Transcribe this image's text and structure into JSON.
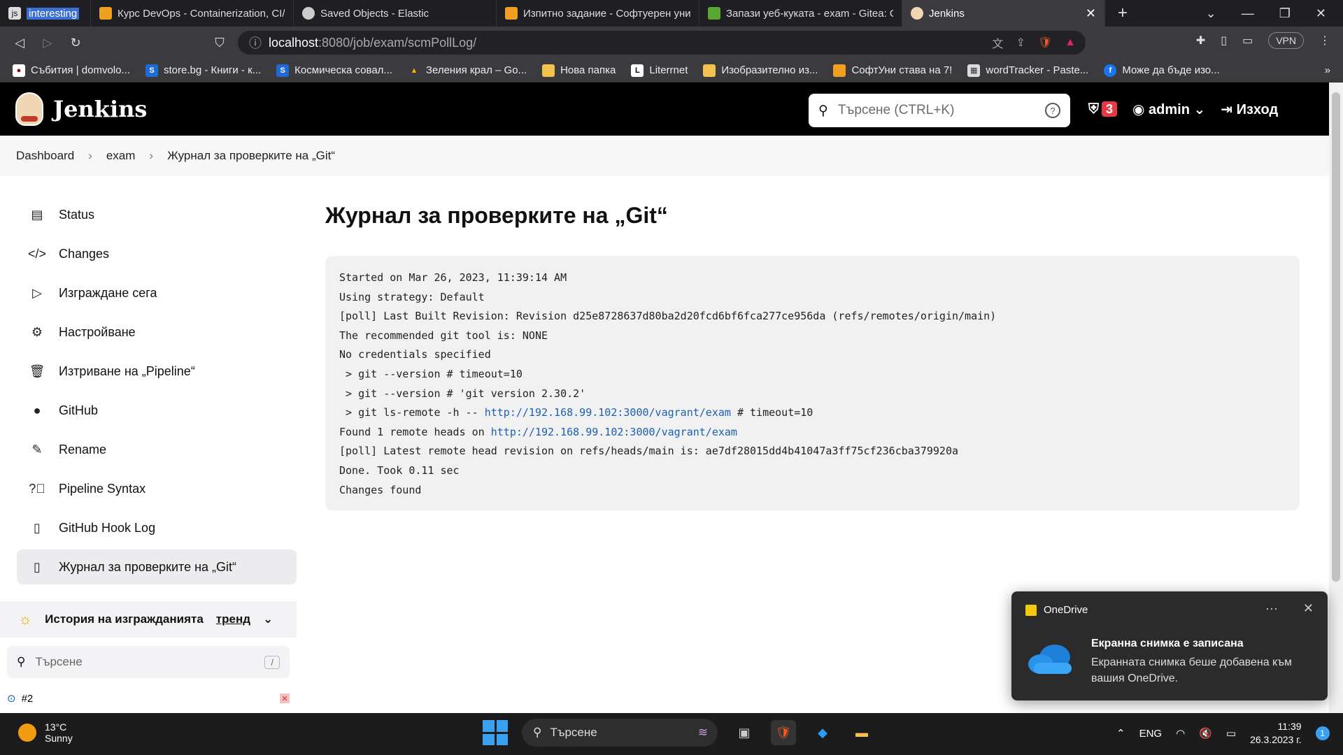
{
  "browser": {
    "tabs": [
      {
        "label": "interesting",
        "icon_text": "js"
      },
      {
        "label": "Курс DevOps - Containerization, CI/C"
      },
      {
        "label": "Saved Objects - Elastic"
      },
      {
        "label": "Изпитно задание - Софтуерен униве"
      },
      {
        "label": "Запази уеб-куката - exam - Gitea: Gi"
      },
      {
        "label": "Jenkins"
      }
    ],
    "url_host": "localhost",
    "url_rest": ":8080/job/exam/scmPollLog/",
    "vpn_label": "VPN",
    "bookmarks": [
      "Събития | domvolo...",
      "store.bg - Книги - к...",
      "Космическа совал...",
      "Зеления крал – Go...",
      "Нова папка",
      "Literrnet",
      "Изобразително из...",
      "СофтУни става на 7!",
      "wordTracker - Paste...",
      "Може да бъде изо..."
    ]
  },
  "jenkins": {
    "title": "Jenkins",
    "search_placeholder": "Търсене (CTRL+K)",
    "security_count": "3",
    "user": "admin",
    "logout": "Изход"
  },
  "breadcrumb": [
    "Dashboard",
    "exam",
    "Журнал за проверките на „Git“"
  ],
  "sidebar": {
    "items": [
      "Status",
      "Changes",
      "Изграждане сега",
      "Настройване",
      "Изтриване на „Pipeline“",
      "GitHub",
      "Rename",
      "Pipeline Syntax",
      "GitHub Hook Log",
      "Журнал за проверките на „Git“"
    ],
    "history_title": "История на изгражданията",
    "history_trend": "тренд",
    "history_search": "Търсене",
    "history_search_key": "/",
    "build_number": "#2"
  },
  "main": {
    "title": "Журнал за проверките на „Git“",
    "log": {
      "l1": "Started on Mar 26, 2023, 11:39:14 AM",
      "l2": "Using strategy: Default",
      "l3": "[poll] Last Built Revision: Revision d25e8728637d80ba2d20fcd6bf6fca277ce956da (refs/remotes/origin/main)",
      "l4": "The recommended git tool is: NONE",
      "l5": "No credentials specified",
      "l6": " > git --version # timeout=10",
      "l7": " > git --version # 'git version 2.30.2'",
      "l8_pre": " > git ls-remote -h -- ",
      "l8_link": "http://192.168.99.102:3000/vagrant/exam",
      "l8_post": " # timeout=10",
      "l9_pre": "Found 1 remote heads on ",
      "l9_link": "http://192.168.99.102:3000/vagrant/exam",
      "l10": "[poll] Latest remote head revision on refs/heads/main is: ae7df28015dd4b41047a3ff75cf236cba379920a",
      "l11": "Done. Took 0.11 sec",
      "l12": "Changes found"
    }
  },
  "toast": {
    "app": "OneDrive",
    "more": "···",
    "title": "Екранна снимка е записана",
    "body": "Екранната снимка беше добавена към вашия OneDrive."
  },
  "taskbar": {
    "temp": "13°C",
    "weather": "Sunny",
    "search": "Търсене",
    "lang": "ENG",
    "time": "11:39",
    "date": "26.3.2023 г.",
    "notif_count": "1"
  }
}
